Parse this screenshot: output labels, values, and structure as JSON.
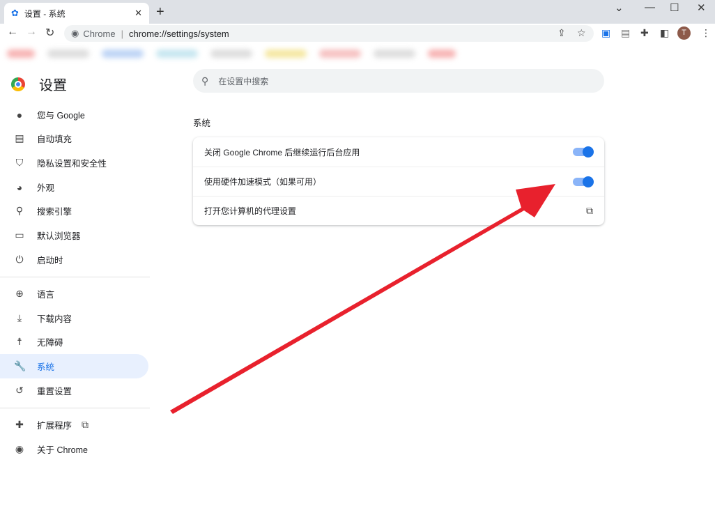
{
  "browser": {
    "tab_title": "设置 - 系统",
    "omnibox_site": "Chrome",
    "omnibox_url": "chrome://settings/system",
    "avatar_letter": "T"
  },
  "settings": {
    "title": "设置",
    "search_placeholder": "在设置中搜索",
    "sidebar": [
      {
        "label": "您与 Google",
        "icon": "person-icon"
      },
      {
        "label": "自动填充",
        "icon": "clipboard-icon"
      },
      {
        "label": "隐私设置和安全性",
        "icon": "shield-icon"
      },
      {
        "label": "外观",
        "icon": "palette-icon"
      },
      {
        "label": "搜索引擎",
        "icon": "search-icon"
      },
      {
        "label": "默认浏览器",
        "icon": "browser-icon"
      },
      {
        "label": "启动时",
        "icon": "power-icon"
      },
      {
        "label": "语言",
        "icon": "globe-icon"
      },
      {
        "label": "下载内容",
        "icon": "download-icon"
      },
      {
        "label": "无障碍",
        "icon": "accessibility-icon"
      },
      {
        "label": "系统",
        "icon": "wrench-icon",
        "active": true
      },
      {
        "label": "重置设置",
        "icon": "restore-icon"
      },
      {
        "label": "扩展程序",
        "icon": "puzzle-icon"
      },
      {
        "label": "关于 Chrome",
        "icon": "chrome-icon"
      }
    ],
    "section_title": "系统",
    "rows": [
      {
        "label": "关闭 Google Chrome 后继续运行后台应用",
        "toggle": true
      },
      {
        "label": "使用硬件加速模式（如果可用）",
        "toggle": true
      },
      {
        "label": "打开您计算机的代理设置",
        "icon": "open-in-new-icon"
      }
    ]
  },
  "colors": {
    "accent": "#1a73e8",
    "annotation_arrow": "#e8212d"
  }
}
